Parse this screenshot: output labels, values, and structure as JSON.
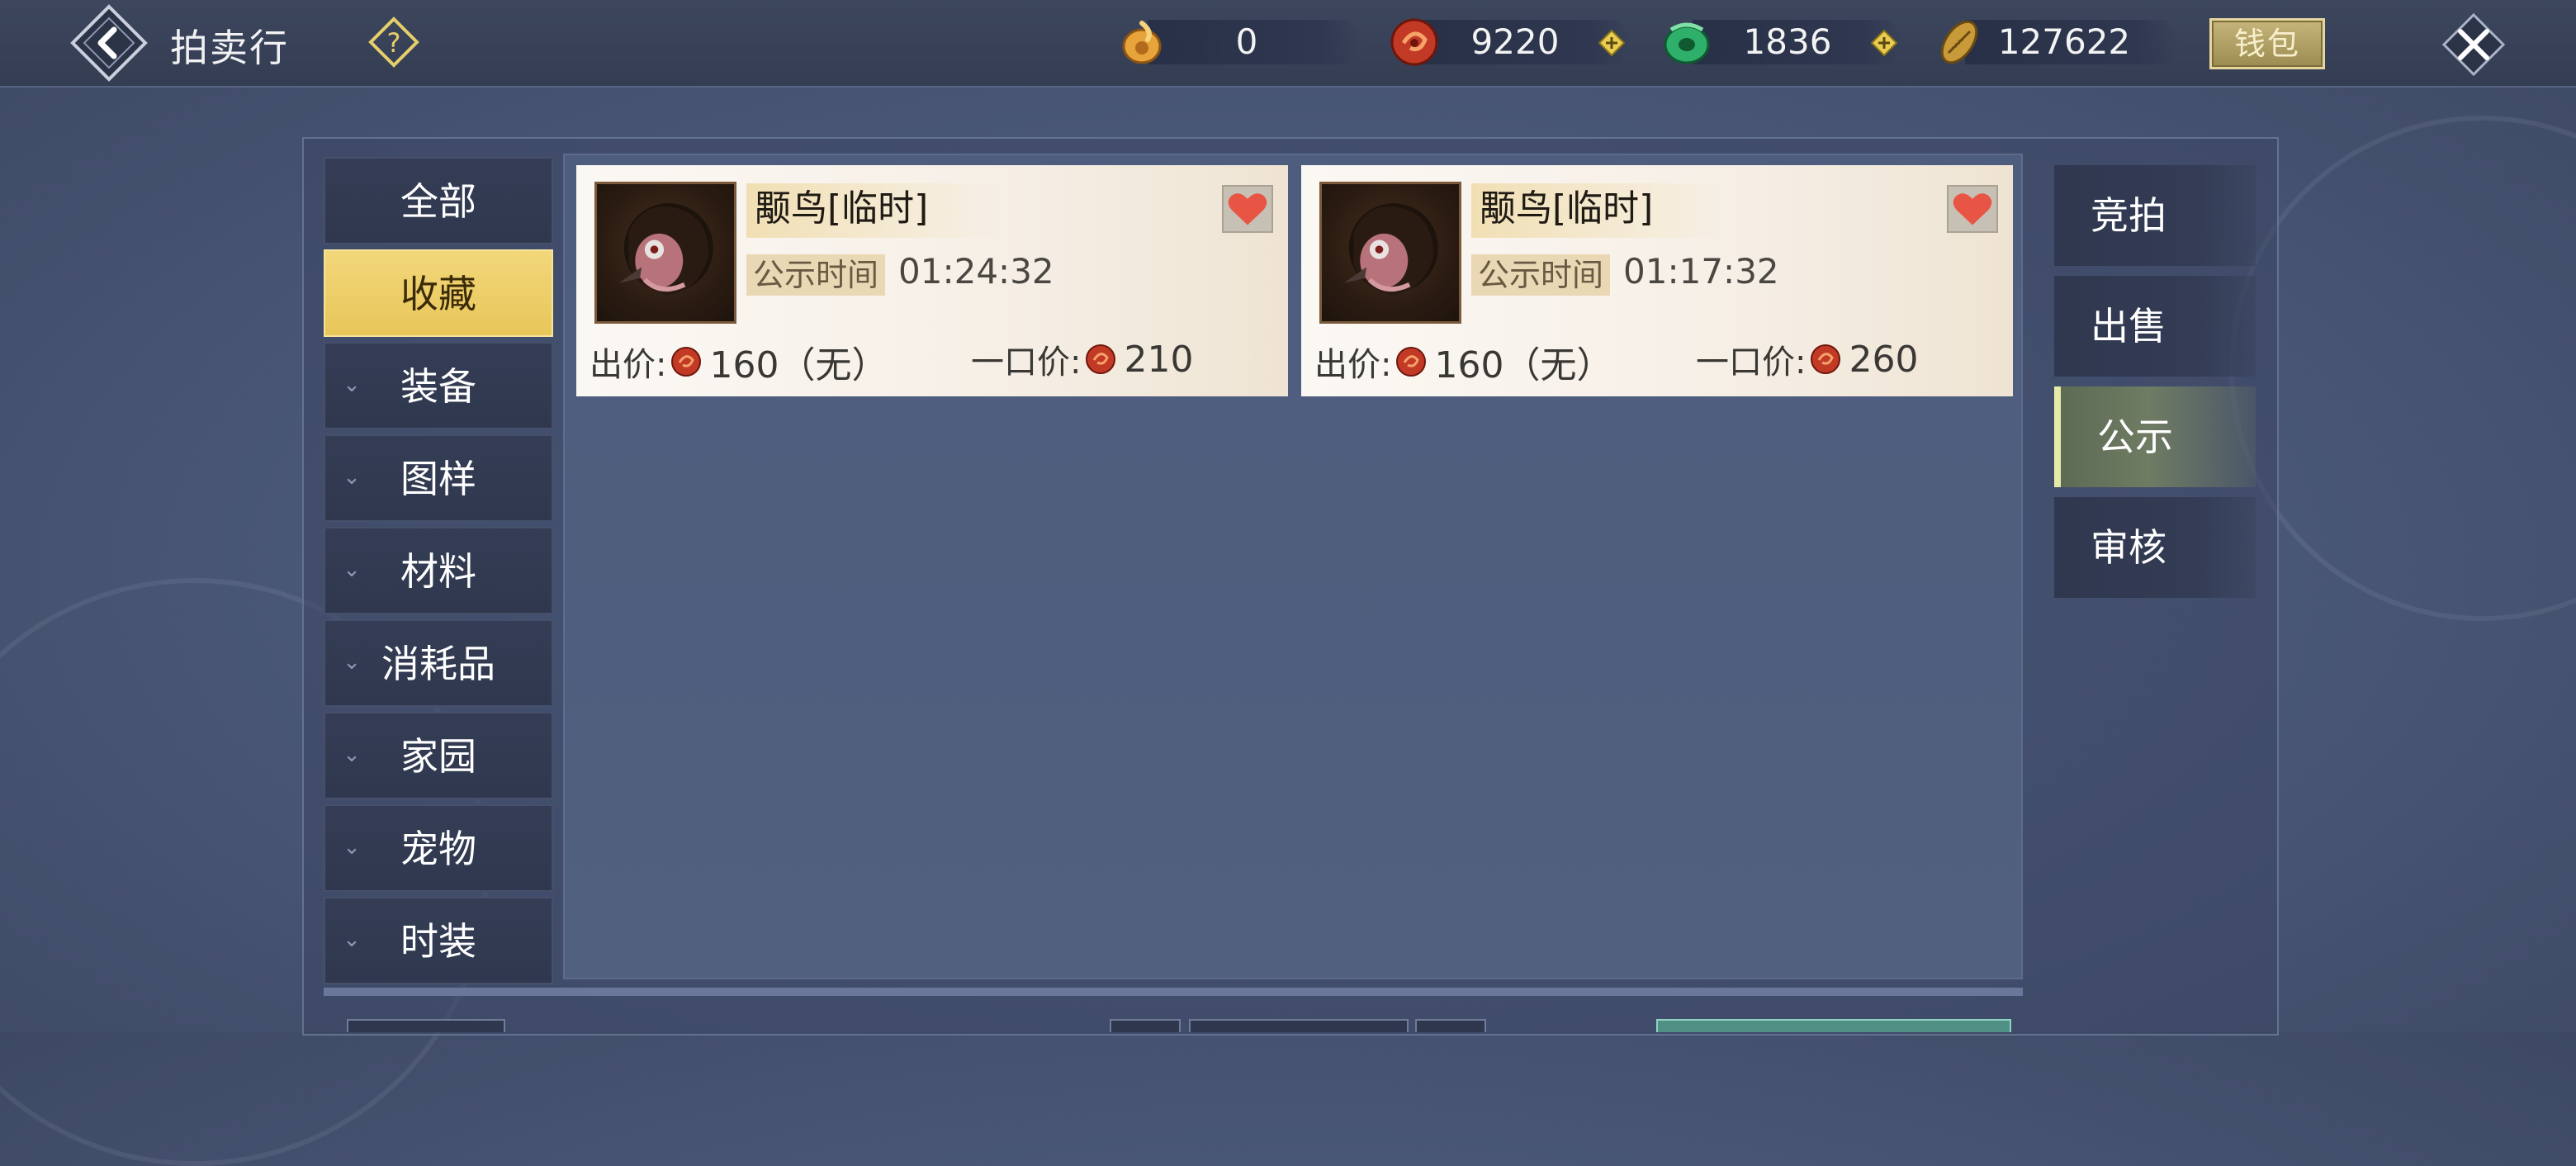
{
  "header": {
    "title": "拍卖行",
    "wallet_label": "钱包"
  },
  "currencies": [
    {
      "icon": "gold-coin-icon",
      "value": "0"
    },
    {
      "icon": "red-coin-icon",
      "value": "9220",
      "plus": true
    },
    {
      "icon": "jade-coin-icon",
      "value": "1836",
      "plus": true
    },
    {
      "icon": "gold-shell-icon",
      "value": "127622"
    }
  ],
  "left_tabs": [
    {
      "label": "全部",
      "expandable": false
    },
    {
      "label": "收藏",
      "expandable": false,
      "active": true
    },
    {
      "label": "装备",
      "expandable": true
    },
    {
      "label": "图样",
      "expandable": true
    },
    {
      "label": "材料",
      "expandable": true
    },
    {
      "label": "消耗品",
      "expandable": true
    },
    {
      "label": "家园",
      "expandable": true
    },
    {
      "label": "宠物",
      "expandable": true
    },
    {
      "label": "时装",
      "expandable": true
    }
  ],
  "right_tabs": [
    {
      "label": "竞拍"
    },
    {
      "label": "出售"
    },
    {
      "label": "公示",
      "active": true
    },
    {
      "label": "审核"
    }
  ],
  "items": [
    {
      "name": "颙鸟[临时]",
      "pub_label": "公示时间",
      "pub_time": "01:24:32",
      "bid_label": "出价:",
      "bid_value": "160（无）",
      "buy_label": "一口价:",
      "buy_value": "210"
    },
    {
      "name": "颙鸟[临时]",
      "pub_label": "公示时间",
      "pub_time": "01:17:32",
      "bid_label": "出价:",
      "bid_value": "160（无）",
      "buy_label": "一口价:",
      "buy_value": "260"
    }
  ],
  "colors": {
    "active_left_tab": "#e8c659",
    "active_right_tab": "#6f7c63",
    "card_bg": "#f6efe6",
    "heart": "#e85545"
  }
}
